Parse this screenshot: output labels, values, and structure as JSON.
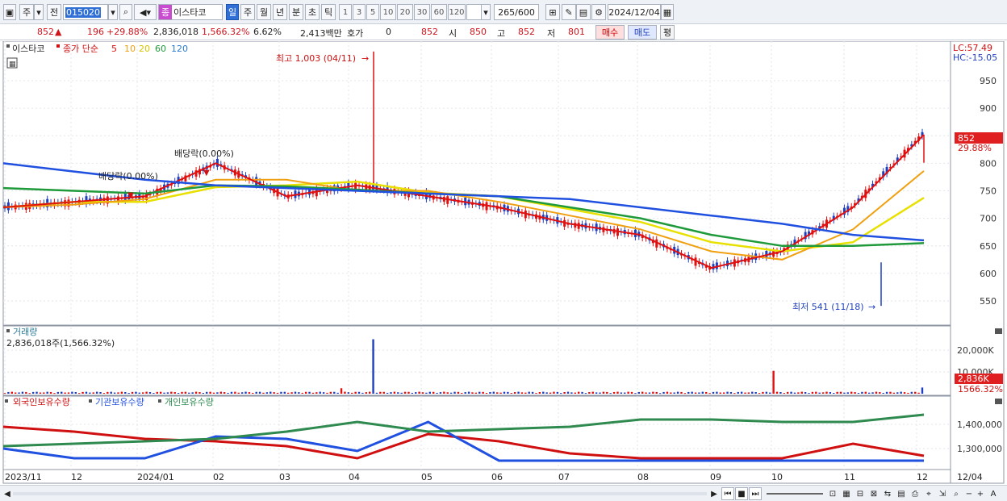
{
  "toolbar": {
    "period_main": "주",
    "prev_label": "전",
    "stock_code": "015020",
    "stock_badge": "종",
    "stock_name": "이스타코",
    "periods": [
      "일",
      "주",
      "월",
      "년",
      "분",
      "초",
      "틱"
    ],
    "active_period": "일",
    "intervals": [
      "1",
      "3",
      "5",
      "10",
      "20",
      "30",
      "60",
      "120"
    ],
    "count_current": "265",
    "count_total": "/600",
    "date": "2024/12/04"
  },
  "quote": {
    "price": "852",
    "change": "196",
    "change_pct": "+29.88%",
    "volume": "2,836,018",
    "volume_ratio": "1,566.32%",
    "turnover": "6.62%",
    "amount": "2,413백만",
    "hoga_label": "호가",
    "hoga_value": "0",
    "hoga_price": "852",
    "open_label": "시",
    "open": "850",
    "high_label": "고",
    "high": "852",
    "low_label": "저",
    "low": "801",
    "buy_label": "매수",
    "sell_label": "매도",
    "avg_label": "평"
  },
  "price_panel": {
    "stock_tag": "이스타코",
    "indicator_label": "종가 단순",
    "ma_periods": [
      "5",
      "10",
      "20",
      "60",
      "120"
    ],
    "ma_colors": [
      "#e01010",
      "#f0a010",
      "#e8e000",
      "#1f9a3a",
      "#2050e0"
    ],
    "lc_label": "LC:57.49",
    "hc_label": "HC:-15.05",
    "price_tag": "852",
    "pct_tag": "29.88%",
    "high_note": "최고 1,003 (04/11)",
    "low_note": "최저 541 (11/18)",
    "dividend_note_1": "배당락(0.00%)",
    "dividend_note_2": "배당락(0.00%)"
  },
  "volume_panel": {
    "title": "거래량",
    "summary": "2,836,018주(1,566.32%)",
    "vol_tag": "2,836K",
    "vol_pct_tag": "1566.32%"
  },
  "holdings_panel": {
    "series_labels": [
      "외국인보유수량",
      "기관보유수량",
      "개인보유수량"
    ],
    "series_colors": [
      "#d01010",
      "#2050e0",
      "#2f8a4f"
    ]
  },
  "x_axis_labels": [
    "2023/11",
    "12",
    "2024/01",
    "02",
    "03",
    "04",
    "05",
    "06",
    "07",
    "08",
    "09",
    "10",
    "11",
    "12",
    "12/04"
  ],
  "chart_data": [
    {
      "type": "line",
      "title": "",
      "subtitle": "이스타코 종가 단순",
      "y_ticks": [
        550,
        600,
        650,
        700,
        750,
        800,
        850,
        900,
        950
      ],
      "x": [
        "2023/11",
        "12",
        "2024/01",
        "02",
        "03",
        "04",
        "05",
        "06",
        "07",
        "08",
        "09",
        "10",
        "11",
        "12"
      ],
      "series": [
        {
          "name": "종가",
          "values": [
            720,
            730,
            740,
            800,
            740,
            760,
            740,
            720,
            690,
            670,
            610,
            640,
            720,
            852
          ]
        },
        {
          "name": "60",
          "values": [
            755,
            750,
            745,
            760,
            758,
            752,
            745,
            740,
            720,
            700,
            670,
            650,
            650,
            655
          ]
        },
        {
          "name": "120",
          "values": [
            800,
            785,
            770,
            760,
            755,
            750,
            745,
            740,
            735,
            720,
            705,
            690,
            670,
            660
          ]
        }
      ],
      "annotations": [
        "최고 1,003 (04/11)",
        "최저 541 (11/18)"
      ]
    },
    {
      "type": "bar",
      "title": "",
      "y_ticks_text": [
        "10,000K",
        "20,000K"
      ],
      "values_note": "2,836,018주"
    },
    {
      "type": "line",
      "title": "",
      "y_ticks": [
        1300000,
        1400000
      ],
      "series": [
        {
          "name": "외국인보유수량",
          "values": [
            1390000,
            1370000,
            1340000,
            1330000,
            1310000,
            1260000,
            1360000,
            1330000,
            1280000,
            1260000,
            1260000,
            1260000,
            1320000,
            1270000
          ]
        },
        {
          "name": "기관보유수량",
          "values": [
            1300000,
            1260000,
            1260000,
            1350000,
            1340000,
            1290000,
            1410000,
            1250000,
            1250000,
            1250000,
            1250000,
            1250000,
            1250000,
            1250000
          ]
        },
        {
          "name": "개인보유수량",
          "values": [
            1310000,
            1320000,
            1330000,
            1340000,
            1370000,
            1410000,
            1370000,
            1380000,
            1390000,
            1420000,
            1420000,
            1410000,
            1410000,
            1440000
          ]
        }
      ]
    }
  ]
}
